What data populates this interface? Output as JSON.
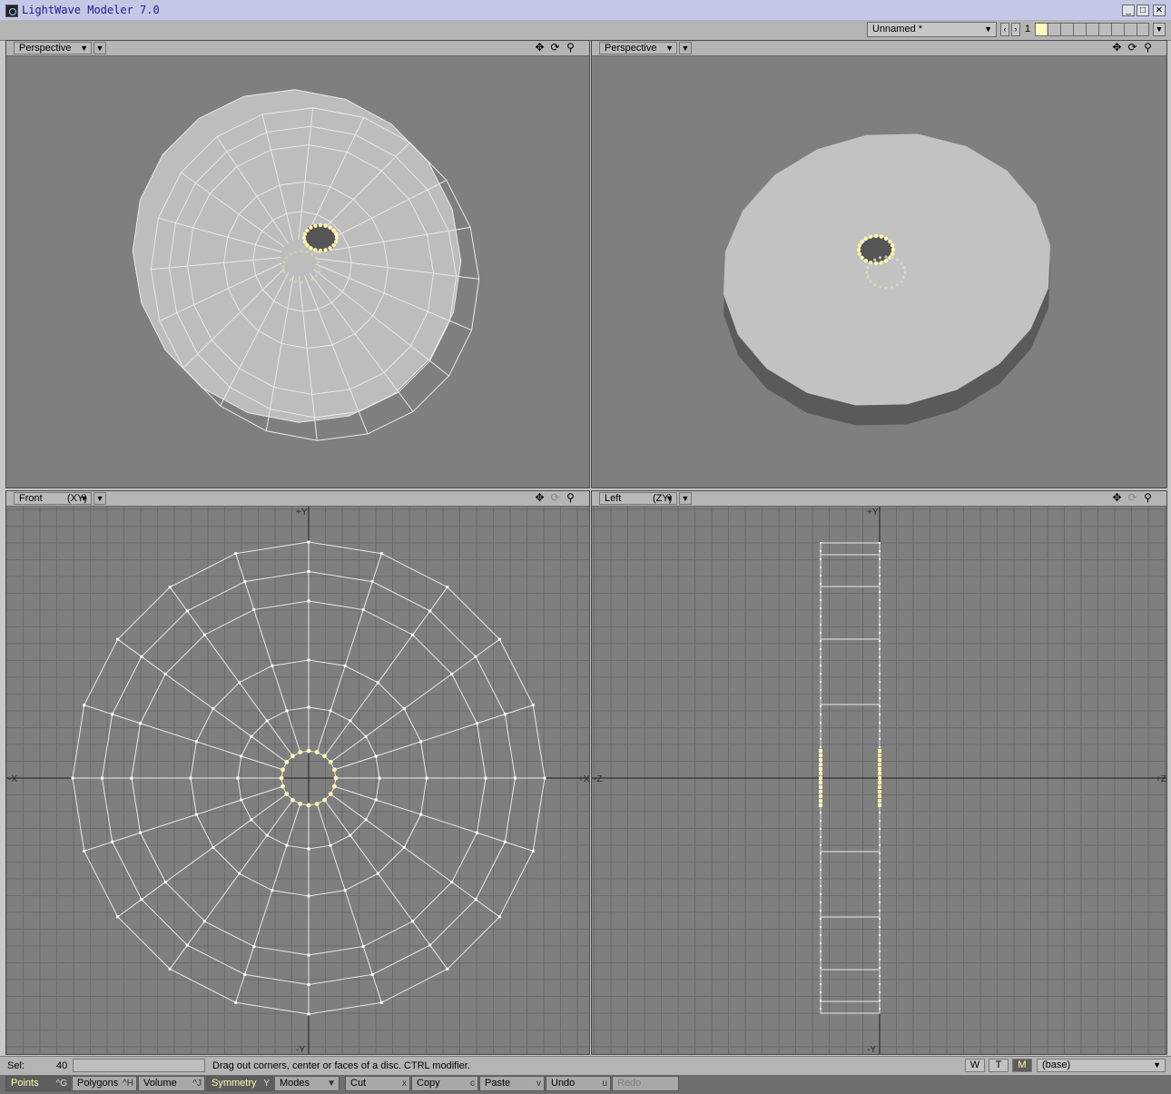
{
  "window": {
    "title": "LightWave Modeler 7.0",
    "minimize": "_",
    "maximize": "□",
    "close": "✕"
  },
  "toolbar": {
    "object_name": "Unnamed *",
    "prev": "‹",
    "next": "›",
    "layer_number": "1"
  },
  "viewports": {
    "top_left": {
      "mode": "Perspective",
      "axis": ""
    },
    "top_right": {
      "mode": "Perspective",
      "axis": ""
    },
    "bottom_left": {
      "mode": "Front",
      "axis": "(XY)"
    },
    "bottom_right": {
      "mode": "Left",
      "axis": "(ZY)"
    }
  },
  "axis_labels": {
    "plus_y": "+Y",
    "minus_y": "-Y",
    "minus_x": "-X",
    "plus_x": "+X",
    "minus_z": "-Z",
    "plus_z": "+Z"
  },
  "tool_icons": [
    "move-view-icon",
    "rotate-view-icon",
    "zoom-view-icon"
  ],
  "status": {
    "sel_label": "Sel:",
    "sel_count": "40",
    "message": "Drag out corners, center or faces of a disc. CTRL modifier.",
    "w": "W",
    "t": "T",
    "m": "M",
    "layer": "(base)"
  },
  "bottom": {
    "points": {
      "label": "Points",
      "key": "^G"
    },
    "polygons": {
      "label": "Polygons",
      "key": "^H"
    },
    "volume": {
      "label": "Volume",
      "key": "^J"
    },
    "symmetry": {
      "label": "Symmetry",
      "key": "Y"
    },
    "modes": {
      "label": "Modes"
    },
    "cut": {
      "label": "Cut",
      "key": "x"
    },
    "copy": {
      "label": "Copy",
      "key": "c"
    },
    "paste": {
      "label": "Paste",
      "key": "v"
    },
    "undo": {
      "label": "Undo",
      "key": "u"
    },
    "redo": {
      "label": "Redo"
    }
  },
  "colors": {
    "viewport_bg": "#7f7f7f",
    "wire": "#e8e8e8",
    "selected_point": "#fff6b0",
    "surface": "#c2c2c2"
  }
}
